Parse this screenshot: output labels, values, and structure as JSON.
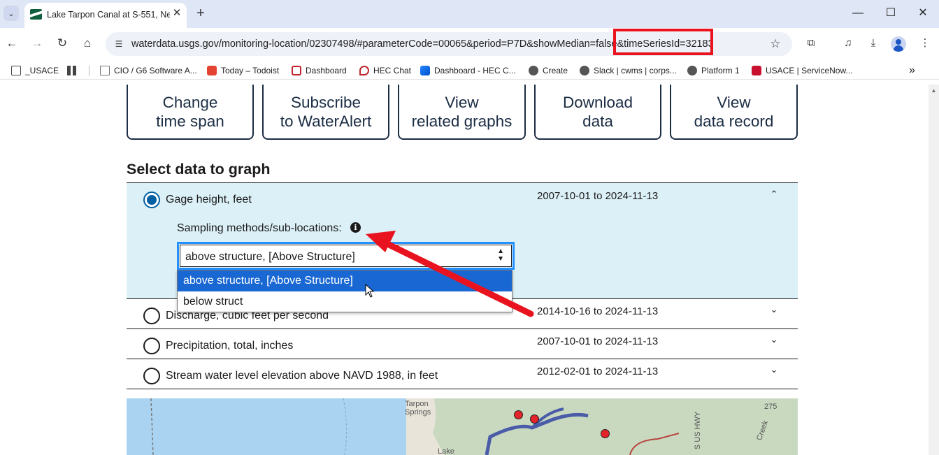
{
  "browser": {
    "tab": {
      "title": "Lake Tarpon Canal at S-551, Ne",
      "close_glyph": "✕"
    },
    "new_tab_glyph": "+",
    "window_controls": {
      "minimize": "—",
      "maximize": "☐",
      "close": "✕"
    },
    "url": "waterdata.usgs.gov/monitoring-location/02307498/#parameterCode=00065&period=P7D&showMedian=false&timeSeriesId=32183",
    "bookmarks": [
      {
        "label": "_USACE",
        "icon": "folder-icon"
      },
      {
        "label": "",
        "icon": "apps-grid-icon"
      },
      {
        "label": "CIO / G6 Software A...",
        "icon": "page-icon"
      },
      {
        "label": "Today – Todoist",
        "icon": "todoist-icon"
      },
      {
        "label": "Dashboard",
        "icon": "dashboard-icon"
      },
      {
        "label": "HEC Chat",
        "icon": "chat-icon"
      },
      {
        "label": "Dashboard - HEC C...",
        "icon": "confluence-icon"
      },
      {
        "label": "Create",
        "icon": "globe-icon"
      },
      {
        "label": "Slack | cwms | corps...",
        "icon": "globe-icon"
      },
      {
        "label": "Platform 1",
        "icon": "globe-icon"
      },
      {
        "label": "USACE | ServiceNow...",
        "icon": "servicenow-icon"
      }
    ],
    "bookmarks_overflow": "»"
  },
  "actions": [
    {
      "line1": "Change",
      "line2": "time span"
    },
    {
      "line1": "Subscribe",
      "line2": "to WaterAlert"
    },
    {
      "line1": "View",
      "line2": "related graphs"
    },
    {
      "line1": "Download",
      "line2": "data"
    },
    {
      "line1": "View",
      "line2": "data record"
    }
  ],
  "section_title": "Select data to graph",
  "parameters": [
    {
      "label": "Gage height, feet",
      "dates": "2007-10-01 to 2024-11-13",
      "selected": true,
      "expanded": true
    },
    {
      "label": "Discharge, cubic feet per second",
      "dates": "2014-10-16 to 2024-11-13",
      "selected": false
    },
    {
      "label": "Precipitation, total, inches",
      "dates": "2007-10-01 to 2024-11-13",
      "selected": false
    },
    {
      "label": "Stream water level elevation above NAVD 1988, in feet",
      "dates": "2012-02-01 to 2024-11-13",
      "selected": false
    }
  ],
  "sampling": {
    "label": "Sampling methods/sub-locations:",
    "info_glyph": "i",
    "value": "above structure, [Above Structure]",
    "options": [
      "above structure, [Above Structure]",
      "below struct"
    ]
  },
  "map": {
    "labels": [
      "Tarpon",
      "Springs",
      "Lake",
      "S US HWY",
      "275",
      "Creek"
    ]
  },
  "annotation": {
    "highlight_color": "#e8131e"
  }
}
